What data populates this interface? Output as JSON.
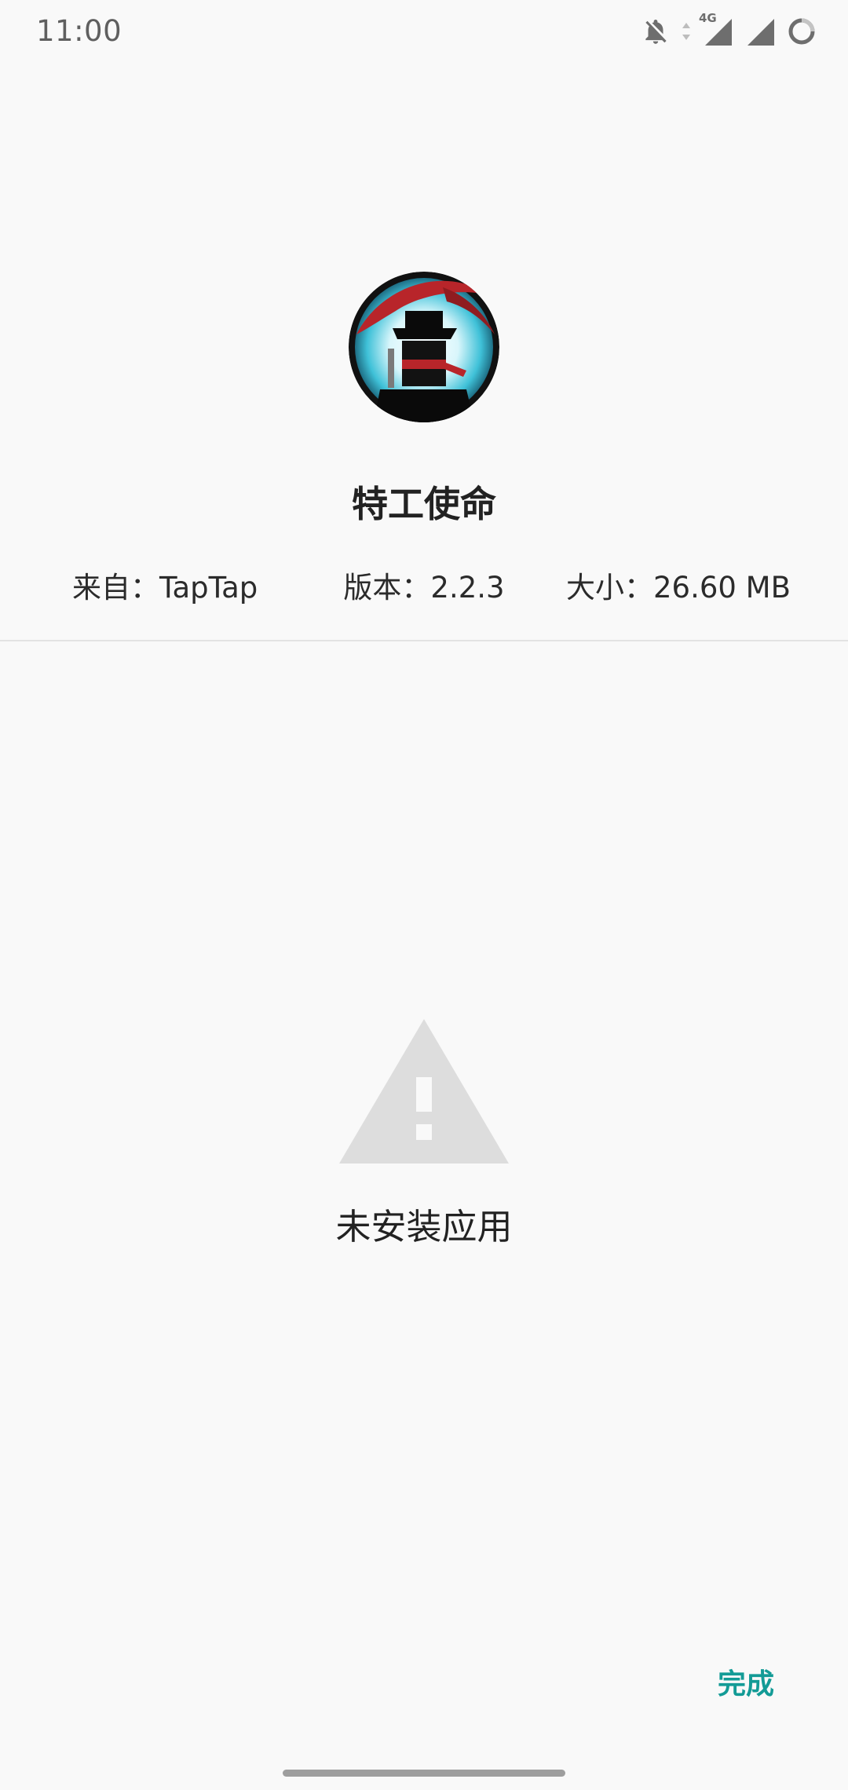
{
  "status_bar": {
    "time": "11:00",
    "network_label": "4G",
    "icons": [
      "bell-off-icon",
      "data-arrows-icon",
      "signal-4g-icon",
      "signal-icon",
      "battery-ring-icon"
    ]
  },
  "app": {
    "name": "特工使命",
    "icon": "app-icon-ninja",
    "source": "来自：TapTap",
    "version": "版本：2.2.3",
    "size": "大小：26.60 MB"
  },
  "result": {
    "icon": "warning-triangle-icon",
    "message": "未安装应用"
  },
  "actions": {
    "done_label": "完成"
  },
  "colors": {
    "background": "#f9f9f9",
    "accent": "#139b96",
    "warning_icon": "#dddddd",
    "divider": "#e3e3e3"
  }
}
